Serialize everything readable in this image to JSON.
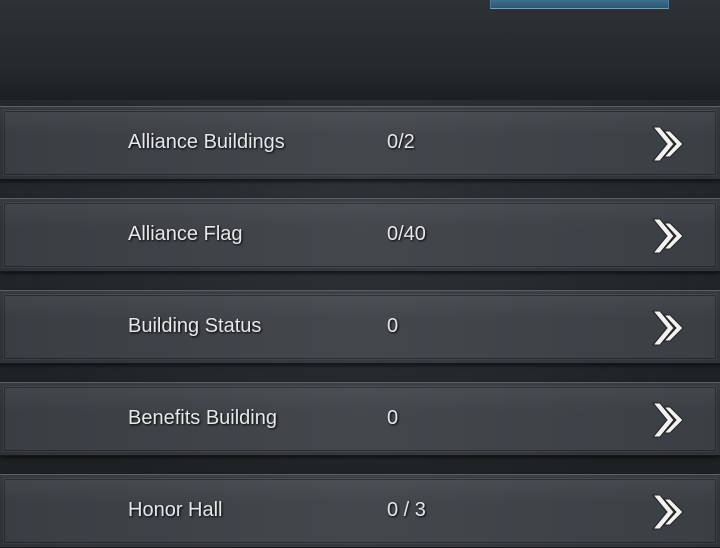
{
  "rows": [
    {
      "label": "Alliance Buildings",
      "value": "0/2"
    },
    {
      "label": "Alliance Flag",
      "value": "0/40"
    },
    {
      "label": "Building Status",
      "value": "0"
    },
    {
      "label": "Benefits Building",
      "value": "0"
    },
    {
      "label": "Honor Hall",
      "value": "0 / 3"
    }
  ],
  "icons": {
    "row_arrow": "double-chevron-right-icon"
  },
  "colors": {
    "banner": "#3d6e8c",
    "text": "#e6e8ea"
  }
}
